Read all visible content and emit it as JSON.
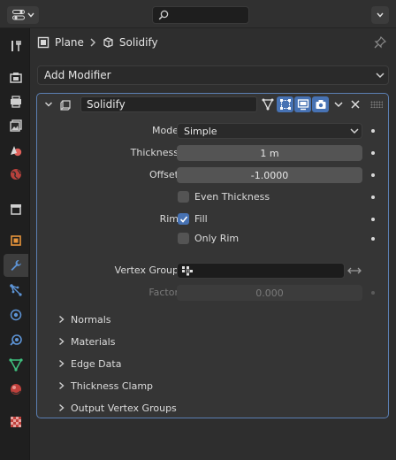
{
  "header": {
    "editor_type_icon": "properties-editor-icon",
    "search_placeholder": "",
    "search_icon": "search-icon"
  },
  "tabs": [
    {
      "name": "tool",
      "icon": "tool-wrench-screwdriver-icon",
      "active": false
    },
    {
      "name": "render",
      "icon": "render-camera-back-icon",
      "active": false
    },
    {
      "name": "output",
      "icon": "output-printer-icon",
      "active": false
    },
    {
      "name": "view-layer",
      "icon": "view-layer-images-icon",
      "active": false
    },
    {
      "name": "scene",
      "icon": "scene-cone-sphere-icon",
      "active": false
    },
    {
      "name": "world",
      "icon": "world-globe-icon",
      "active": false
    },
    {
      "name": "collection",
      "icon": "collection-box-icon",
      "active": false
    },
    {
      "name": "object",
      "icon": "object-square-icon",
      "active": false
    },
    {
      "name": "modifiers",
      "icon": "modifier-wrench-icon",
      "active": true
    },
    {
      "name": "particles",
      "icon": "particles-icon",
      "active": false
    },
    {
      "name": "physics",
      "icon": "physics-orbit-icon",
      "active": false
    },
    {
      "name": "constraints",
      "icon": "constraints-icon",
      "active": false
    },
    {
      "name": "data",
      "icon": "mesh-data-triangle-icon",
      "active": false
    },
    {
      "name": "material",
      "icon": "material-sphere-icon",
      "active": false
    },
    {
      "name": "texture",
      "icon": "texture-checker-icon",
      "active": false
    }
  ],
  "breadcrumb": {
    "object": "Plane",
    "modifier": "Solidify"
  },
  "add_modifier": {
    "label": "Add Modifier"
  },
  "modifier": {
    "name": "Solidify",
    "mode_label": "Mode",
    "mode_value": "Simple",
    "thickness_label": "Thickness",
    "thickness_value": "1 m",
    "offset_label": "Offset",
    "offset_value": "-1.0000",
    "even_thickness_label": "Even Thickness",
    "even_thickness_checked": false,
    "rim_label": "Rim",
    "fill_label": "Fill",
    "fill_checked": true,
    "only_rim_label": "Only Rim",
    "only_rim_checked": false,
    "vertex_group_label": "Vertex Group",
    "vertex_group_value": "",
    "factor_label": "Factor",
    "factor_value": "0.000",
    "subpanels": [
      "Normals",
      "Materials",
      "Edge Data",
      "Thickness Clamp",
      "Output Vertex Groups"
    ]
  },
  "colors": {
    "accent": "#4772b3",
    "panel_outline": "#5b7fb3",
    "background": "#2e2e2e"
  }
}
